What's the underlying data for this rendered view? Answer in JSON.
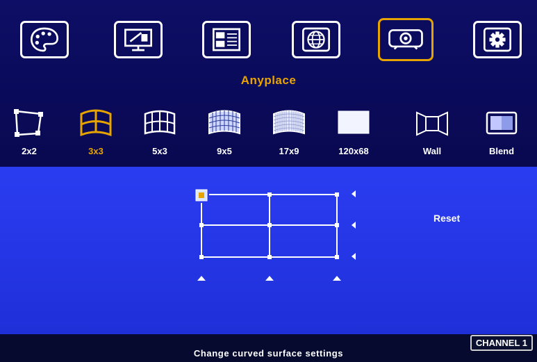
{
  "top_menu": {
    "icons": [
      {
        "name": "palette-icon",
        "selected": false
      },
      {
        "name": "display-settings-icon",
        "selected": false
      },
      {
        "name": "layout-icon",
        "selected": false
      },
      {
        "name": "network-globe-icon",
        "selected": false
      },
      {
        "name": "projector-icon",
        "selected": true
      },
      {
        "name": "gear-icon",
        "selected": false
      }
    ],
    "title": "Anyplace"
  },
  "options": [
    {
      "label": "2x2",
      "icon": "2x2-corner-icon",
      "selected": false
    },
    {
      "label": "3x3",
      "icon": "3x3-curve-icon",
      "selected": true
    },
    {
      "label": "5x3",
      "icon": "5x3-curve-icon",
      "selected": false
    },
    {
      "label": "9x5",
      "icon": "9x5-curve-icon",
      "selected": false
    },
    {
      "label": "17x9",
      "icon": "17x9-curve-icon",
      "selected": false
    },
    {
      "label": "120x68",
      "icon": "120x68-grid-icon",
      "selected": false
    },
    {
      "label": "Wall",
      "icon": "wall-icon",
      "selected": false
    },
    {
      "label": "Blend",
      "icon": "blend-icon",
      "selected": false
    }
  ],
  "grid_editor": {
    "reset_label": "Reset"
  },
  "status_bar": {
    "message": "Change curved surface settings",
    "channel": "CHANNEL 1"
  },
  "colors": {
    "accent": "#e6a400",
    "top_bg": "#0e0e66",
    "work_bg": "#2536e6",
    "bottom_bg": "#050a2e"
  }
}
